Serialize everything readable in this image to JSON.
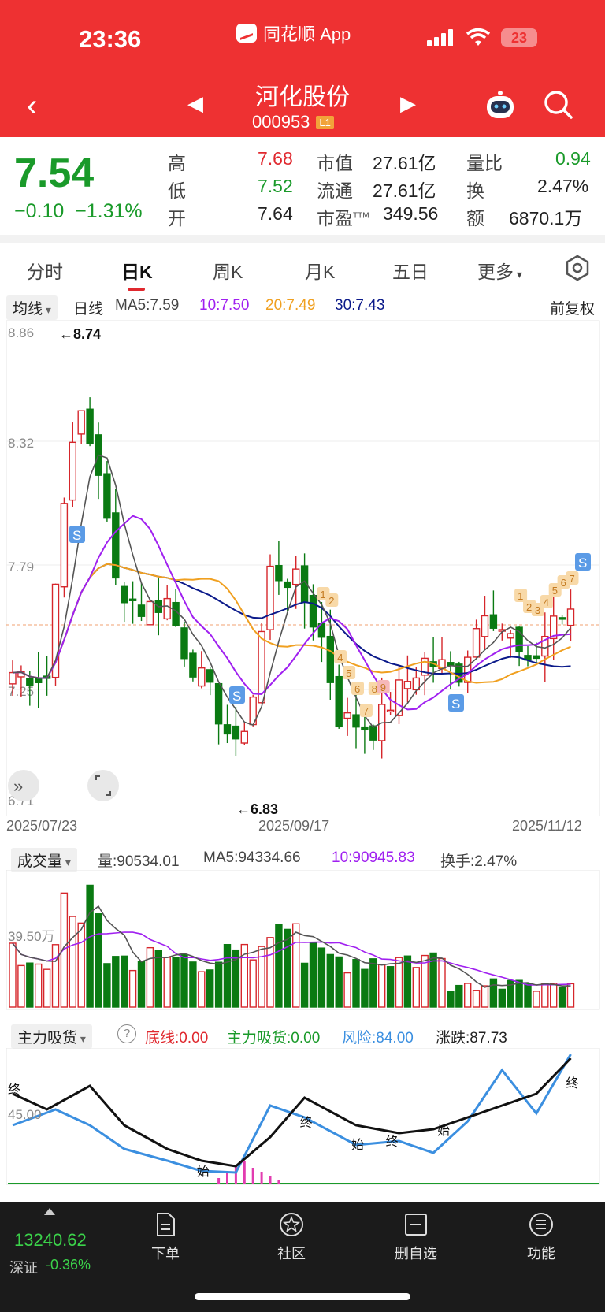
{
  "status": {
    "time": "23:36",
    "app": "同花顺 App",
    "battery": "23"
  },
  "stock": {
    "name": "河化股份",
    "code": "000953",
    "badge": "L1"
  },
  "quote": {
    "price": "7.54",
    "change": "−0.10",
    "change_pct": "−1.31%",
    "high_label": "高",
    "high": "7.68",
    "low_label": "低",
    "low": "7.52",
    "open_label": "开",
    "open": "7.64",
    "mktcap_label": "市值",
    "mktcap": "27.61亿",
    "float_label": "流通",
    "float": "27.61亿",
    "pe_label": "市盈",
    "pe_sup": "TTM",
    "pe": "349.56",
    "volratio_label": "量比",
    "volratio": "0.94",
    "turnover_label": "换",
    "turnover": "2.47%",
    "amount_label": "额",
    "amount": "6870.1万"
  },
  "tabs": [
    "分时",
    "日K",
    "周K",
    "月K",
    "五日",
    "更多"
  ],
  "ma_row": {
    "dropdown": "均线",
    "period": "日线",
    "ma5": "MA5:7.59",
    "ma10": "10:7.50",
    "ma20": "20:7.49",
    "ma30": "30:7.43",
    "adjust": "前复权"
  },
  "kchart": {
    "y_ticks": [
      "8.86",
      "8.32",
      "7.79",
      "7.25",
      "6.71"
    ],
    "dates": [
      "2025/07/23",
      "2025/09/17",
      "2025/11/12"
    ],
    "max_label": "←8.74",
    "min_label": "←6.83",
    "signals": [
      "S",
      "S",
      "S",
      "S"
    ],
    "td_counts": [
      "1",
      "2",
      "4",
      "5",
      "6",
      "7",
      "8",
      "9",
      "1",
      "2",
      "3",
      "4",
      "5",
      "6",
      "7"
    ]
  },
  "vol_row": {
    "dropdown": "成交量",
    "vol": "量:90534.01",
    "ma5": "MA5:94334.66",
    "ma10": "10:90945.83",
    "turnover": "换手:2.47%",
    "tick": "39.50万"
  },
  "ind_row": {
    "dropdown": "主力吸货",
    "q": "?",
    "base": "底线:0.00",
    "main": "主力吸货:0.00",
    "risk": "风险:84.00",
    "rise": "涨跌:87.73",
    "tick": "45.00",
    "marks": [
      "终",
      "始",
      "终",
      "始",
      "终",
      "始",
      "终"
    ]
  },
  "colors": {
    "up": "#d6262b",
    "down": "#0a7a12",
    "ma5": "#444444",
    "ma10": "#a020f0",
    "ma20": "#f0a020",
    "ma30": "#0b1a8a"
  },
  "bottom": {
    "index_value": "13240.62",
    "index_name": "深证",
    "index_chg": "-0.36%",
    "nav": [
      "下单",
      "社区",
      "删自选",
      "功能"
    ]
  }
}
